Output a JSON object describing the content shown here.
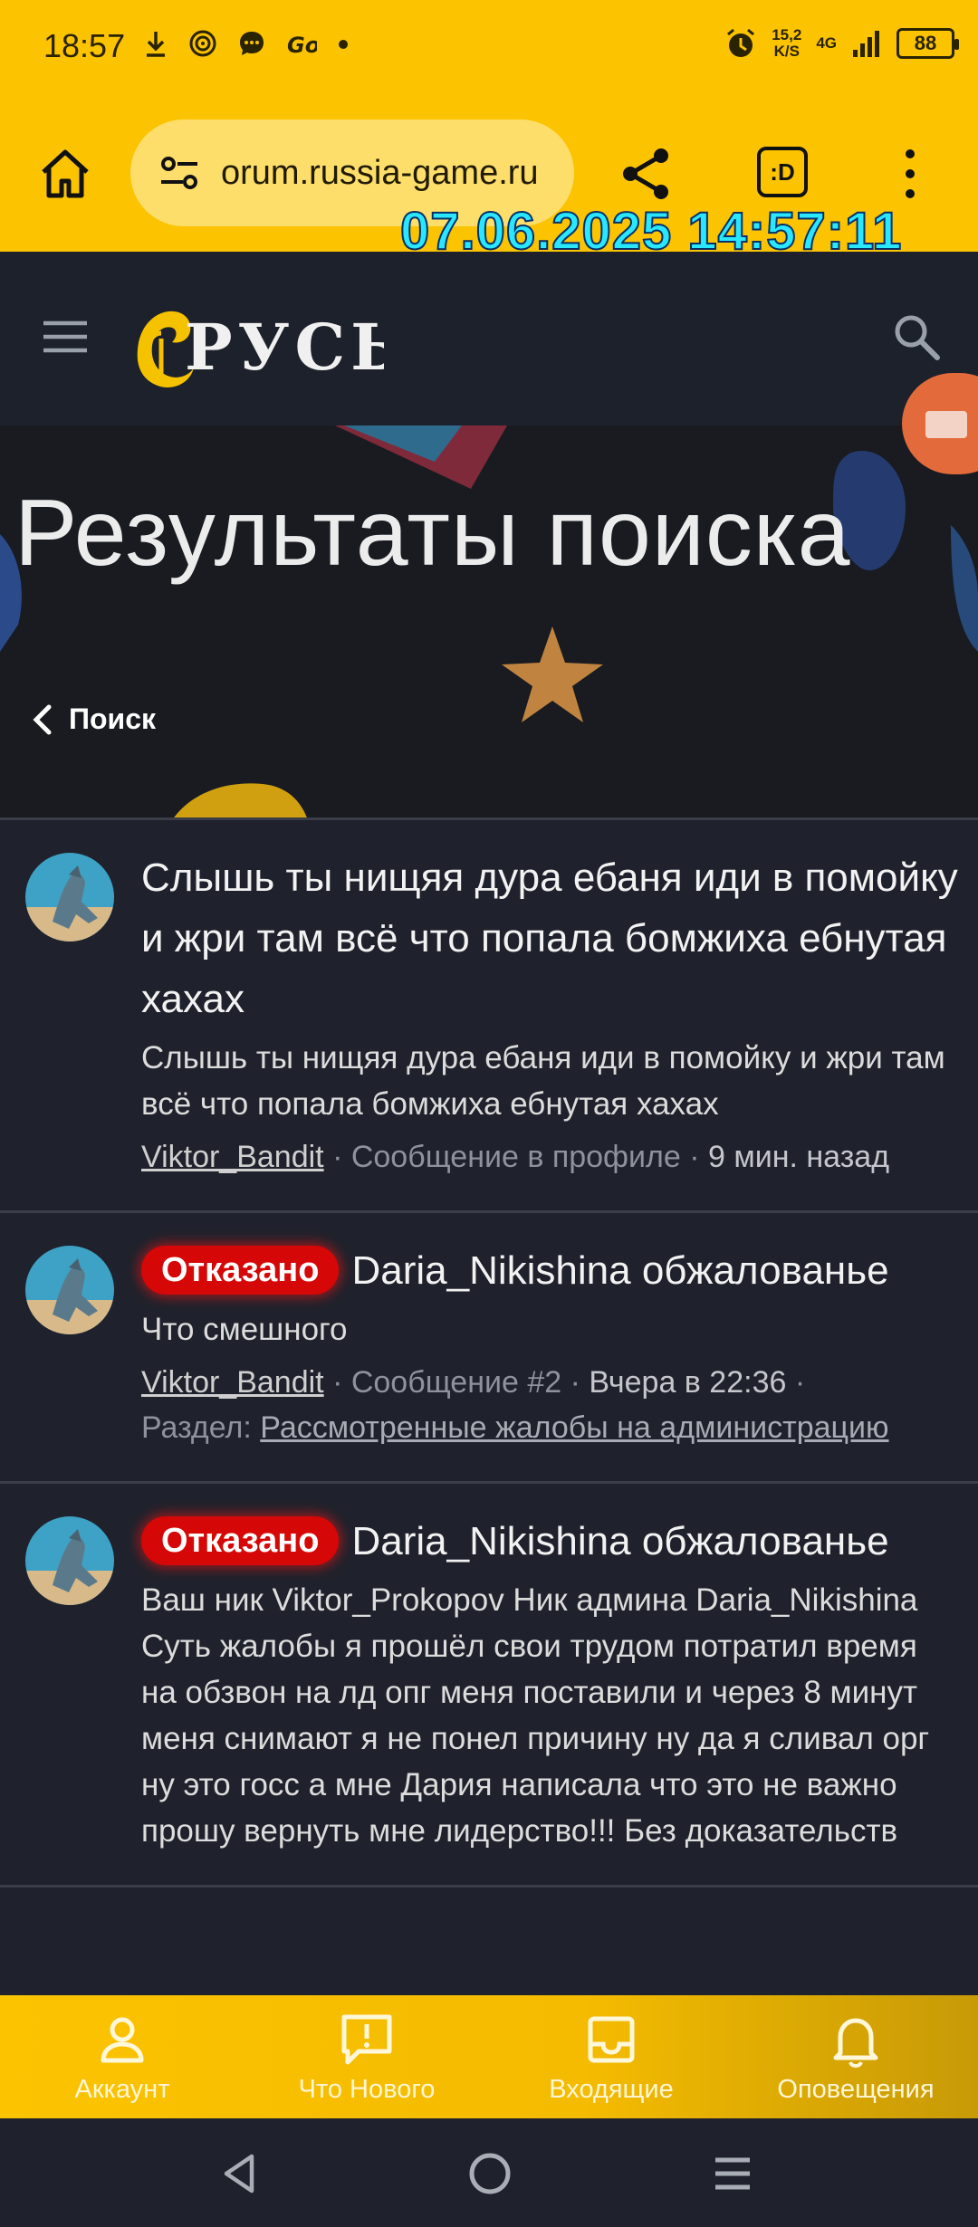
{
  "status_bar": {
    "time": "18:57",
    "left_icons": [
      "download-icon",
      "target-icon",
      "chat-icon",
      "go-icon",
      "dot-icon"
    ],
    "speed_value": "15,2",
    "speed_unit": "K/S",
    "network": "4G",
    "battery": "88"
  },
  "browser": {
    "url": "orum.russia-game.ru",
    "tab_button": ":D",
    "timestamp_overlay": "07.06.2025 14:57:11"
  },
  "header": {
    "logo_alt": "РУСЬ"
  },
  "hero": {
    "title": "Результаты поиска",
    "back_label": "Поиск"
  },
  "results": [
    {
      "badge": "",
      "title": "Слышь ты нищяя дура ебаня иди в помойку и жри там всё что попала бомжиха ебнутая хахах",
      "snippet": "Слышь ты нищяя дура ебаня иди в помойку и жри там всё что попала бомжиха ебнутая хахах",
      "author": "Viktor_Bandit",
      "meta_type": "Сообщение в профиле",
      "meta_time": "9 мин. назад"
    },
    {
      "badge": "Отказано",
      "title": "Daria_Nikishina обжалованье",
      "snippet": "Что смешного",
      "author": "Viktor_Bandit",
      "meta_type": "Сообщение #2",
      "meta_time": "Вчера в 22:36",
      "section_label": "Раздел:",
      "section_link": "Рассмотренные жалобы на администрацию"
    },
    {
      "badge": "Отказано",
      "title": "Daria_Nikishina обжалованье",
      "snippet": "Ваш ник Viktor_Prokopov Ник админа Daria_Nikishina Суть жалобы я прошёл свои трудом потратил время на обзвон на лд опг меня поставили и через 8 минут меня снимают я не понел причину ну да я сливал орг ну это госс а мне Дария написала что это не важно прошу вернуть мне лидерство!!! Без доказательств"
    }
  ],
  "bottom_nav": [
    {
      "label": "Аккаунт",
      "icon": "account-icon"
    },
    {
      "label": "Что Нового",
      "icon": "whats-new-icon"
    },
    {
      "label": "Входящие",
      "icon": "inbox-icon"
    },
    {
      "label": "Оповещения",
      "icon": "bell-icon"
    }
  ],
  "colors": {
    "accent_yellow": "#fbc300",
    "background": "#1f222c",
    "badge_red": "#d50707",
    "timestamp_cyan": "#29e7ff"
  }
}
